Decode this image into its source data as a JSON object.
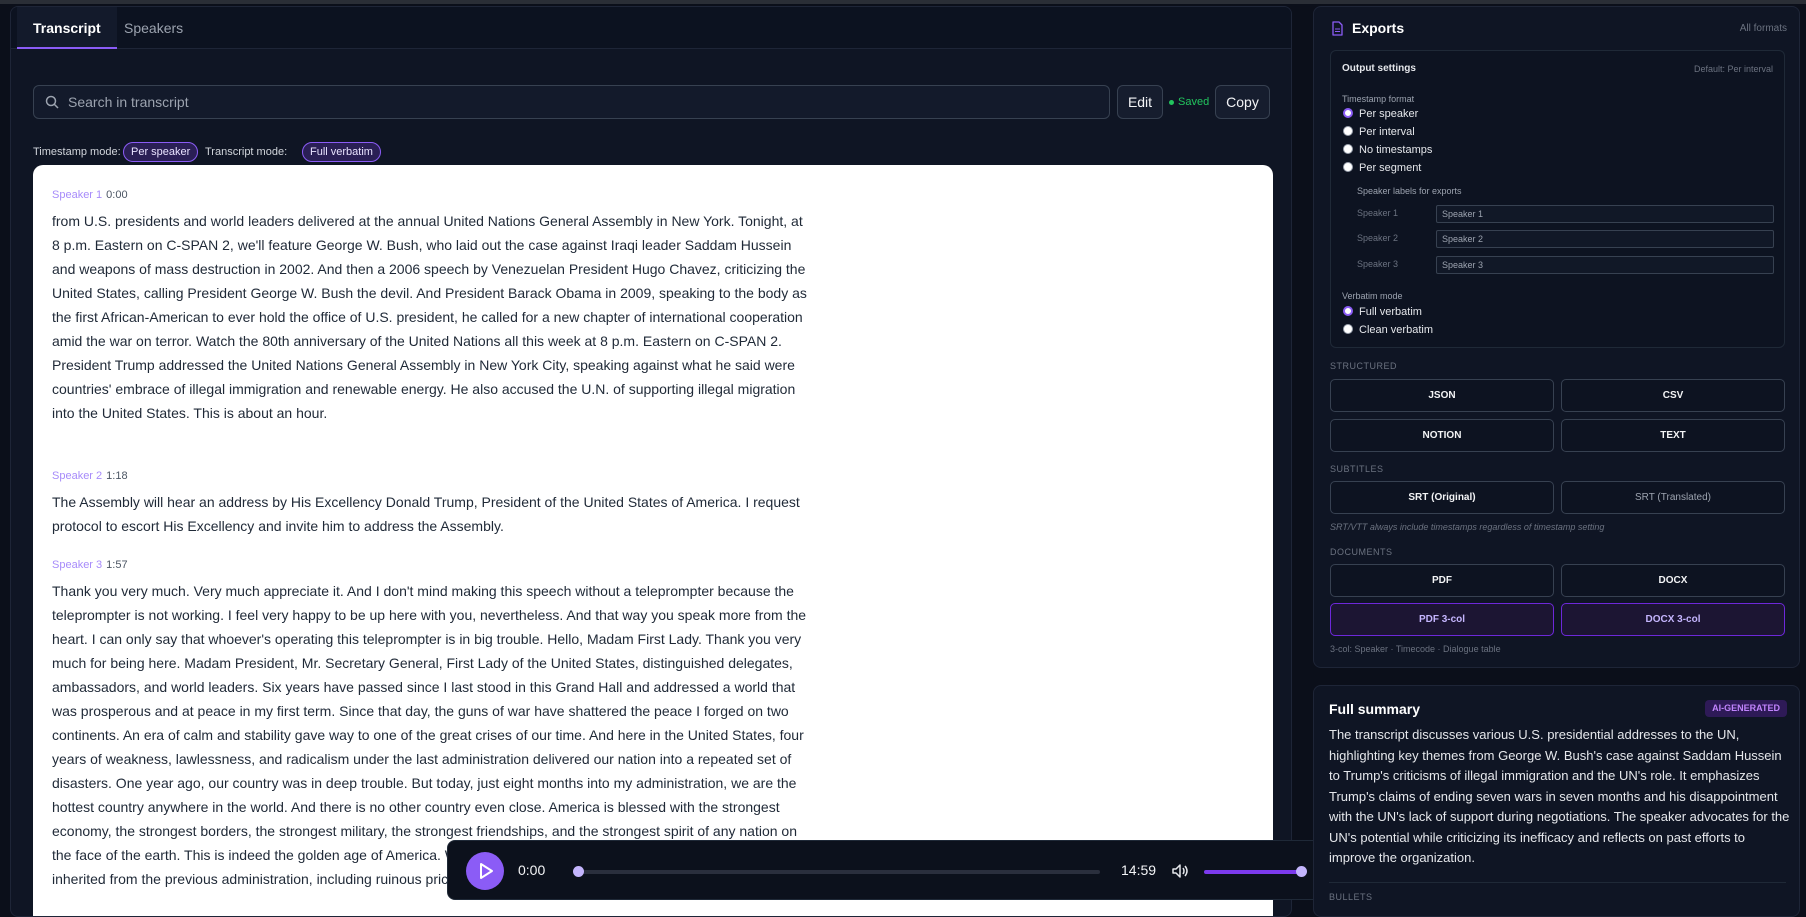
{
  "tabs": [
    {
      "label": "Transcript"
    },
    {
      "label": "Speakers"
    }
  ],
  "search": {
    "placeholder": "Search in transcript"
  },
  "toolbar": {
    "edit_label": "Edit",
    "saved_label": "Saved",
    "copy_label": "Copy"
  },
  "modes": {
    "timestamp_label": "Timestamp mode:",
    "timestamp_value": "Per speaker",
    "transcript_label": "Transcript mode:",
    "transcript_value": "Full verbatim"
  },
  "transcript": [
    {
      "speaker": "Speaker 1",
      "time": "0:00",
      "text": "from U.S. presidents and world leaders delivered at the annual United Nations General Assembly in New York. Tonight, at 8 p.m. Eastern on C-SPAN 2, we'll feature George W. Bush, who laid out the case against Iraqi leader Saddam Hussein and weapons of mass destruction in 2002. And then a 2006 speech by Venezuelan President Hugo Chavez, criticizing the United States, calling President George W. Bush the devil. And President Barack Obama in 2009, speaking to the body as the first African-American to ever hold the office of U.S. president, he called for a new chapter of international cooperation amid the war on terror. Watch the 80th anniversary of the United Nations all this week at 8 p.m. Eastern on C-SPAN 2. President Trump addressed the United Nations General Assembly in New York City, speaking against what he said were countries' embrace of illegal immigration and renewable energy. He also accused the U.N. of supporting illegal migration into the United States. This is about an hour."
    },
    {
      "speaker": "Speaker 2",
      "time": "1:18",
      "text": "The Assembly will hear an address by His Excellency Donald Trump, President of the United States of America. I request protocol to escort His Excellency and invite him to address the Assembly."
    },
    {
      "speaker": "Speaker 3",
      "time": "1:57",
      "text": "Thank you very much. Very much appreciate it. And I don't mind making this speech without a teleprompter because the teleprompter is not working. I feel very happy to be up here with you, nevertheless. And that way you speak more from the heart. I can only say that whoever's operating this teleprompter is in big trouble. Hello, Madam First Lady. Thank you very much for being here. Madam President, Mr. Secretary General, First Lady of the United States, distinguished delegates, ambassadors, and world leaders. Six years have passed since I last stood in this Grand Hall and addressed a world that was prosperous and at peace in my first term. Since that day, the guns of war have shattered the peace I forged on two continents. An era of calm and stability gave way to one of the great crises of our time. And here in the United States, four years of weakness, lawlessness, and radicalism under the last administration delivered our nation into a repeated set of disasters. One year ago, our country was in deep trouble. But today, just eight months into my administration, we are the hottest country anywhere in the world. And there is no other country even close. America is blessed with the strongest economy, the strongest borders, the strongest military, the strongest friendships, and the strongest spirit of any nation on the face of the earth. This is indeed the golden age of America. We are rapidly reversing the economic calamity that we inherited from the previous administration, including ruinous price increases and record-setting inflation. Inflation like"
    }
  ],
  "player": {
    "current": "0:00",
    "duration": "14:59",
    "progress": 0,
    "volume": 0.92
  },
  "exports": {
    "title": "Exports",
    "subtitle": "All formats",
    "output_settings": {
      "title": "Output settings",
      "default": "Default: Per interval"
    },
    "timestamp_format": {
      "label": "Timestamp format",
      "options": [
        "Per speaker",
        "Per interval",
        "No timestamps",
        "Per segment"
      ],
      "selected": "Per speaker"
    },
    "speaker_labels": {
      "label": "Speaker labels for exports",
      "rows": [
        {
          "name": "Speaker 1",
          "value": "Speaker 1"
        },
        {
          "name": "Speaker 2",
          "value": "Speaker 2"
        },
        {
          "name": "Speaker 3",
          "value": "Speaker 3"
        }
      ]
    },
    "verbatim_mode": {
      "label": "Verbatim mode",
      "options": [
        "Full verbatim",
        "Clean verbatim"
      ],
      "selected": "Full verbatim"
    },
    "structured": {
      "label": "STRUCTURED",
      "buttons": [
        "JSON",
        "CSV",
        "NOTION",
        "TEXT"
      ]
    },
    "subtitles": {
      "label": "SUBTITLES",
      "buttons": [
        "SRT (Original)",
        "SRT (Translated)"
      ],
      "note": "SRT/VTT always include timestamps regardless of timestamp setting"
    },
    "documents": {
      "label": "DOCUMENTS",
      "buttons": [
        "PDF",
        "DOCX",
        "PDF 3-col",
        "DOCX 3-col"
      ],
      "note": "3-col: Speaker · Timecode · Dialogue table"
    }
  },
  "summary": {
    "title": "Full summary",
    "badge": "AI-GENERATED",
    "text": "The transcript discusses various U.S. presidential addresses to the UN, highlighting key themes from George W. Bush's case against Saddam Hussein to Trump's criticisms of illegal immigration and the UN's role. It emphasizes Trump's claims of ending seven wars in seven months and his disappointment with the UN's lack of support during negotiations. The speaker advocates for the UN's potential while criticizing its inefficacy and reflects on past efforts to improve the organization.",
    "bullets_label": "BULLETS"
  },
  "colors": {
    "accent": "#8b5cf6",
    "saved": "#22c55e",
    "bg": "#0b0f1a",
    "panel": "#0f1524"
  }
}
